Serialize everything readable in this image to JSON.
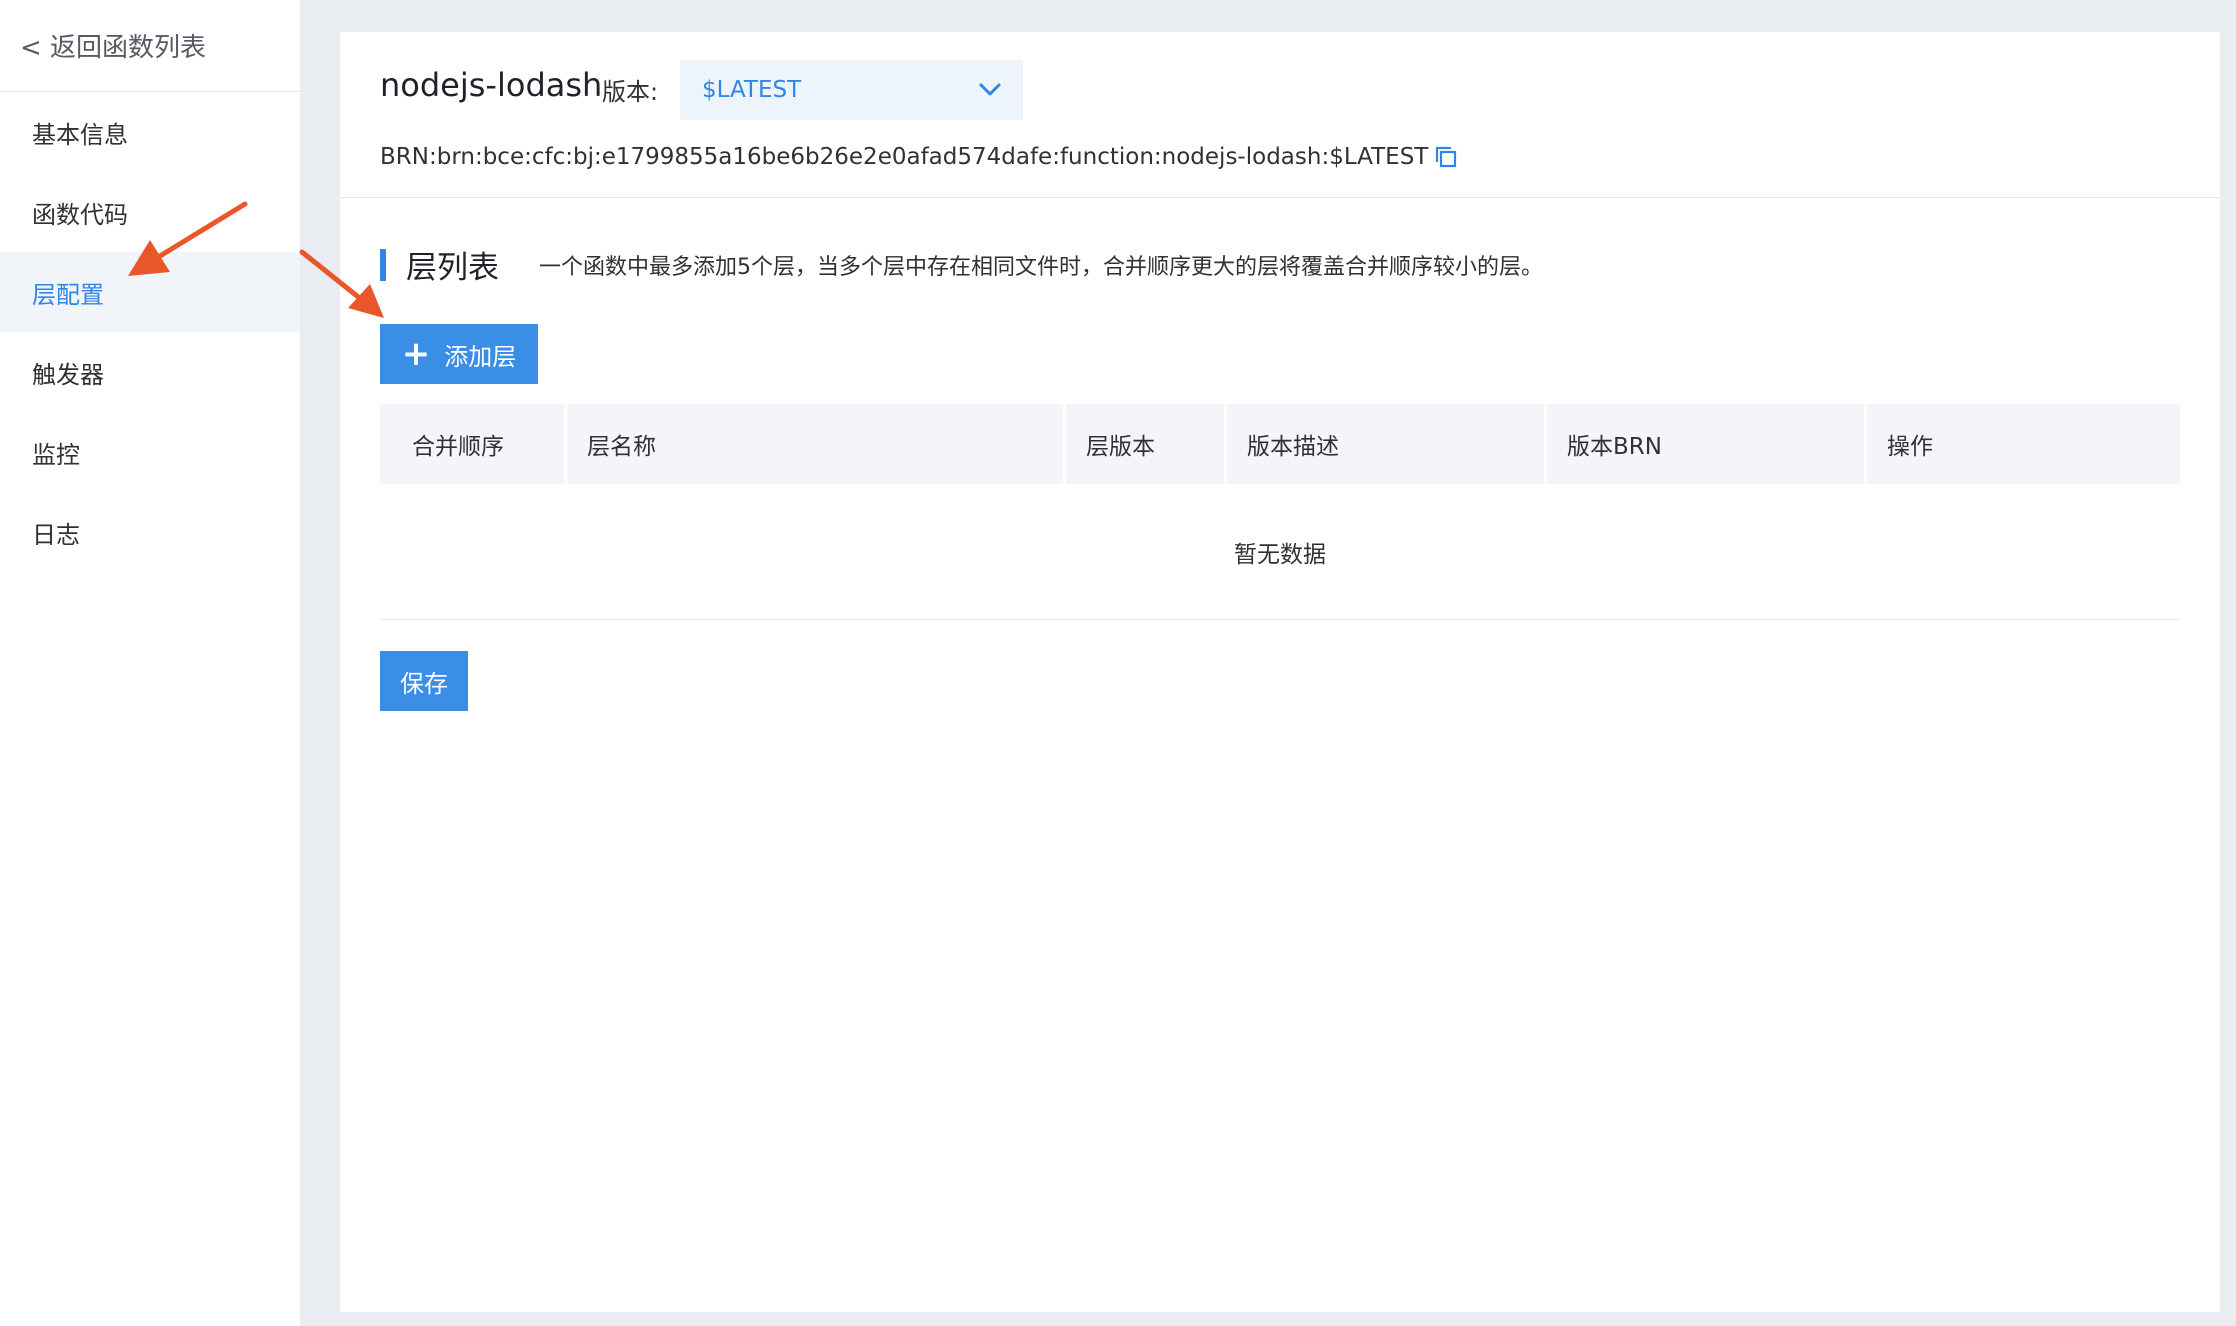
{
  "sidebar": {
    "back_label": "< 返回函数列表",
    "items": [
      {
        "label": "基本信息",
        "active": false
      },
      {
        "label": "函数代码",
        "active": false
      },
      {
        "label": "层配置",
        "active": true
      },
      {
        "label": "触发器",
        "active": false
      },
      {
        "label": "监控",
        "active": false
      },
      {
        "label": "日志",
        "active": false
      }
    ]
  },
  "header": {
    "function_name": "nodejs-lodash",
    "version_label": "版本:",
    "version_value": "$LATEST",
    "brn_label": "BRN:",
    "brn_value": "brn:bce:cfc:bj:e1799855a16be6b26e2e0afad574dafe:function:nodejs-lodash:$LATEST"
  },
  "section": {
    "title": "层列表",
    "description": "一个函数中最多添加5个层，当多个层中存在相同文件时，合并顺序更大的层将覆盖合并顺序较小的层。",
    "add_button_label": "添加层"
  },
  "table": {
    "columns": [
      "合并顺序",
      "层名称",
      "层版本",
      "版本描述",
      "版本BRN",
      "操作"
    ],
    "empty_text": "暂无数据"
  },
  "footer": {
    "save_label": "保存"
  },
  "colors": {
    "accent": "#2f86e8",
    "button": "#3a8ee6",
    "annotation_arrow": "#e8562a"
  }
}
